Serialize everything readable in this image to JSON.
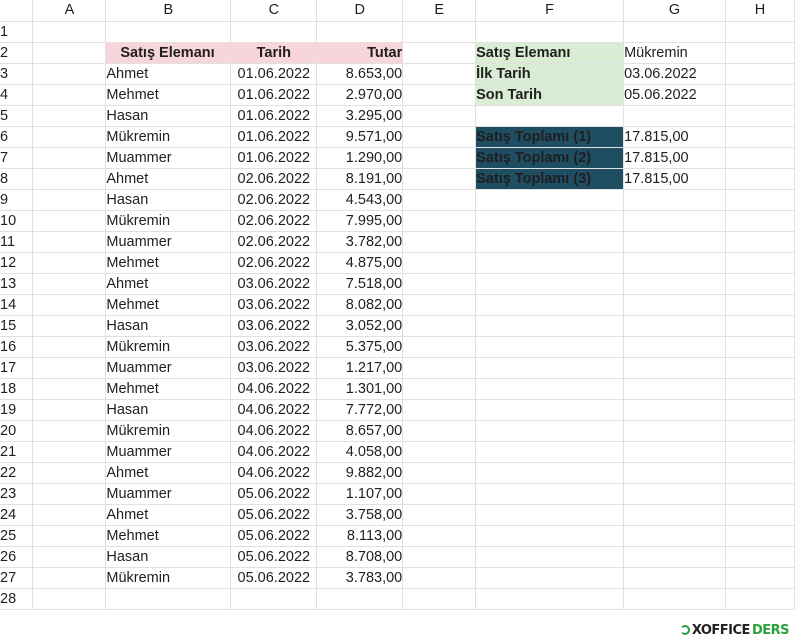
{
  "columns": [
    "A",
    "B",
    "C",
    "D",
    "E",
    "F",
    "G",
    "H"
  ],
  "row_numbers": [
    "1",
    "2",
    "3",
    "4",
    "5",
    "6",
    "7",
    "8",
    "9",
    "10",
    "11",
    "12",
    "13",
    "14",
    "15",
    "16",
    "17",
    "18",
    "19",
    "20",
    "21",
    "22",
    "23",
    "24",
    "25",
    "26",
    "27",
    "28"
  ],
  "sales_table": {
    "headers": {
      "name": "Satış Elemanı",
      "date": "Tarih",
      "amount": "Tutar"
    },
    "rows": [
      [
        "Ahmet",
        "01.06.2022",
        "8.653,00"
      ],
      [
        "Mehmet",
        "01.06.2022",
        "2.970,00"
      ],
      [
        "Hasan",
        "01.06.2022",
        "3.295,00"
      ],
      [
        "Mükremin",
        "01.06.2022",
        "9.571,00"
      ],
      [
        "Muammer",
        "01.06.2022",
        "1.290,00"
      ],
      [
        "Ahmet",
        "02.06.2022",
        "8.191,00"
      ],
      [
        "Hasan",
        "02.06.2022",
        "4.543,00"
      ],
      [
        "Mükremin",
        "02.06.2022",
        "7.995,00"
      ],
      [
        "Muammer",
        "02.06.2022",
        "3.782,00"
      ],
      [
        "Mehmet",
        "02.06.2022",
        "4.875,00"
      ],
      [
        "Ahmet",
        "03.06.2022",
        "7.518,00"
      ],
      [
        "Mehmet",
        "03.06.2022",
        "8.082,00"
      ],
      [
        "Hasan",
        "03.06.2022",
        "3.052,00"
      ],
      [
        "Mükremin",
        "03.06.2022",
        "5.375,00"
      ],
      [
        "Muammer",
        "03.06.2022",
        "1.217,00"
      ],
      [
        "Mehmet",
        "04.06.2022",
        "1.301,00"
      ],
      [
        "Hasan",
        "04.06.2022",
        "7.772,00"
      ],
      [
        "Mükremin",
        "04.06.2022",
        "8.657,00"
      ],
      [
        "Muammer",
        "04.06.2022",
        "4.058,00"
      ],
      [
        "Ahmet",
        "04.06.2022",
        "9.882,00"
      ],
      [
        "Muammer",
        "05.06.2022",
        "1.107,00"
      ],
      [
        "Ahmet",
        "05.06.2022",
        "3.758,00"
      ],
      [
        "Mehmet",
        "05.06.2022",
        "8.113,00"
      ],
      [
        "Hasan",
        "05.06.2022",
        "8.708,00"
      ],
      [
        "Mükremin",
        "05.06.2022",
        "3.783,00"
      ]
    ]
  },
  "criteria": {
    "seller_label": "Satış Elemanı",
    "seller_value": "Mükremin",
    "start_label": "İlk Tarih",
    "start_value": "03.06.2022",
    "end_label": "Son Tarih",
    "end_value": "05.06.2022"
  },
  "totals": [
    {
      "label": "Satış Toplamı (1)",
      "value": "17.815,00"
    },
    {
      "label": "Satış Toplamı (2)",
      "value": "17.815,00"
    },
    {
      "label": "Satış Toplamı (3)",
      "value": "17.815,00"
    }
  ],
  "watermark": {
    "part1": "XOFFICE",
    "part2": "DERS"
  },
  "colors": {
    "pink_header_bg": "#f7d5da",
    "pink_header_text": "#7d2738",
    "green_label_bg": "#d9ecd4",
    "navy_label_bg": "#1f4e63",
    "grid_line": "#e1e1e1"
  }
}
